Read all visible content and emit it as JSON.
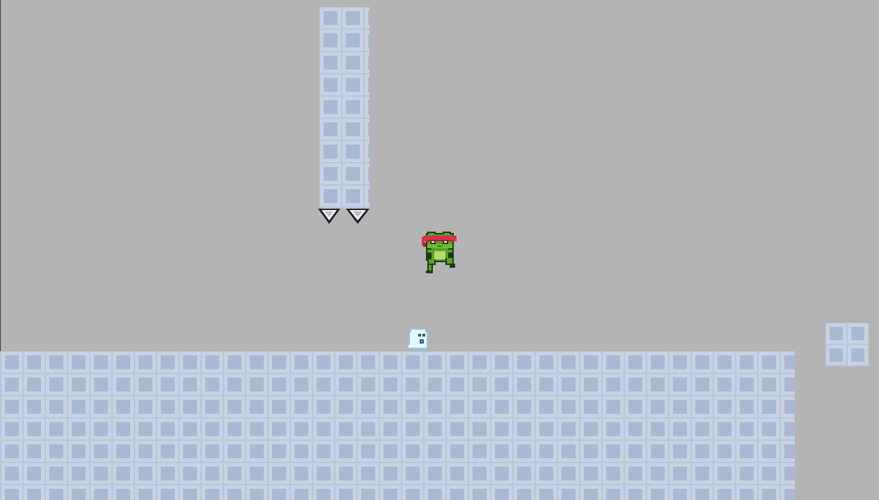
{
  "scene": {
    "type": "platformer-level",
    "background_color": "#b4b4b4",
    "tile_colors": {
      "tile_light": "#c8d2e1",
      "tile_inner": "#a9b8d3",
      "tile_edge": "#b7c4da"
    }
  },
  "objects": {
    "player": {
      "name": "frog-ninja",
      "headband_color": "#d8304a",
      "body_color": "#5aa02c",
      "state": "jumping"
    },
    "enemy": {
      "name": "ghost",
      "body_color": "#e8f6fb"
    },
    "hazard": {
      "name": "ceiling-spikes",
      "count": 2
    },
    "platforms": [
      "ground-floor",
      "ceiling-pillar",
      "floating-ledge"
    ]
  }
}
